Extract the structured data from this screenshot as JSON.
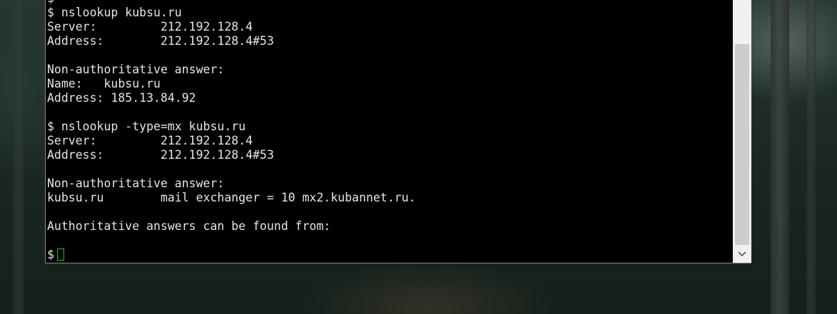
{
  "terminal": {
    "lines": [
      "$",
      "$ nslookup kubsu.ru",
      "Server:         212.192.128.4",
      "Address:        212.192.128.4#53",
      "",
      "Non-authoritative answer:",
      "Name:   kubsu.ru",
      "Address: 185.13.84.92",
      "",
      "$ nslookup -type=mx kubsu.ru",
      "Server:         212.192.128.4",
      "Address:        212.192.128.4#53",
      "",
      "Non-authoritative answer:",
      "kubsu.ru        mail exchanger = 10 mx2.kubannet.ru.",
      "",
      "Authoritative answers can be found from:",
      "",
      "$"
    ],
    "cursor_color": "#18c818",
    "text_color": "#e6e6e6",
    "background_color": "#000000"
  },
  "scrollbar": {
    "down_arrow_icon": "chevron-down-icon"
  }
}
